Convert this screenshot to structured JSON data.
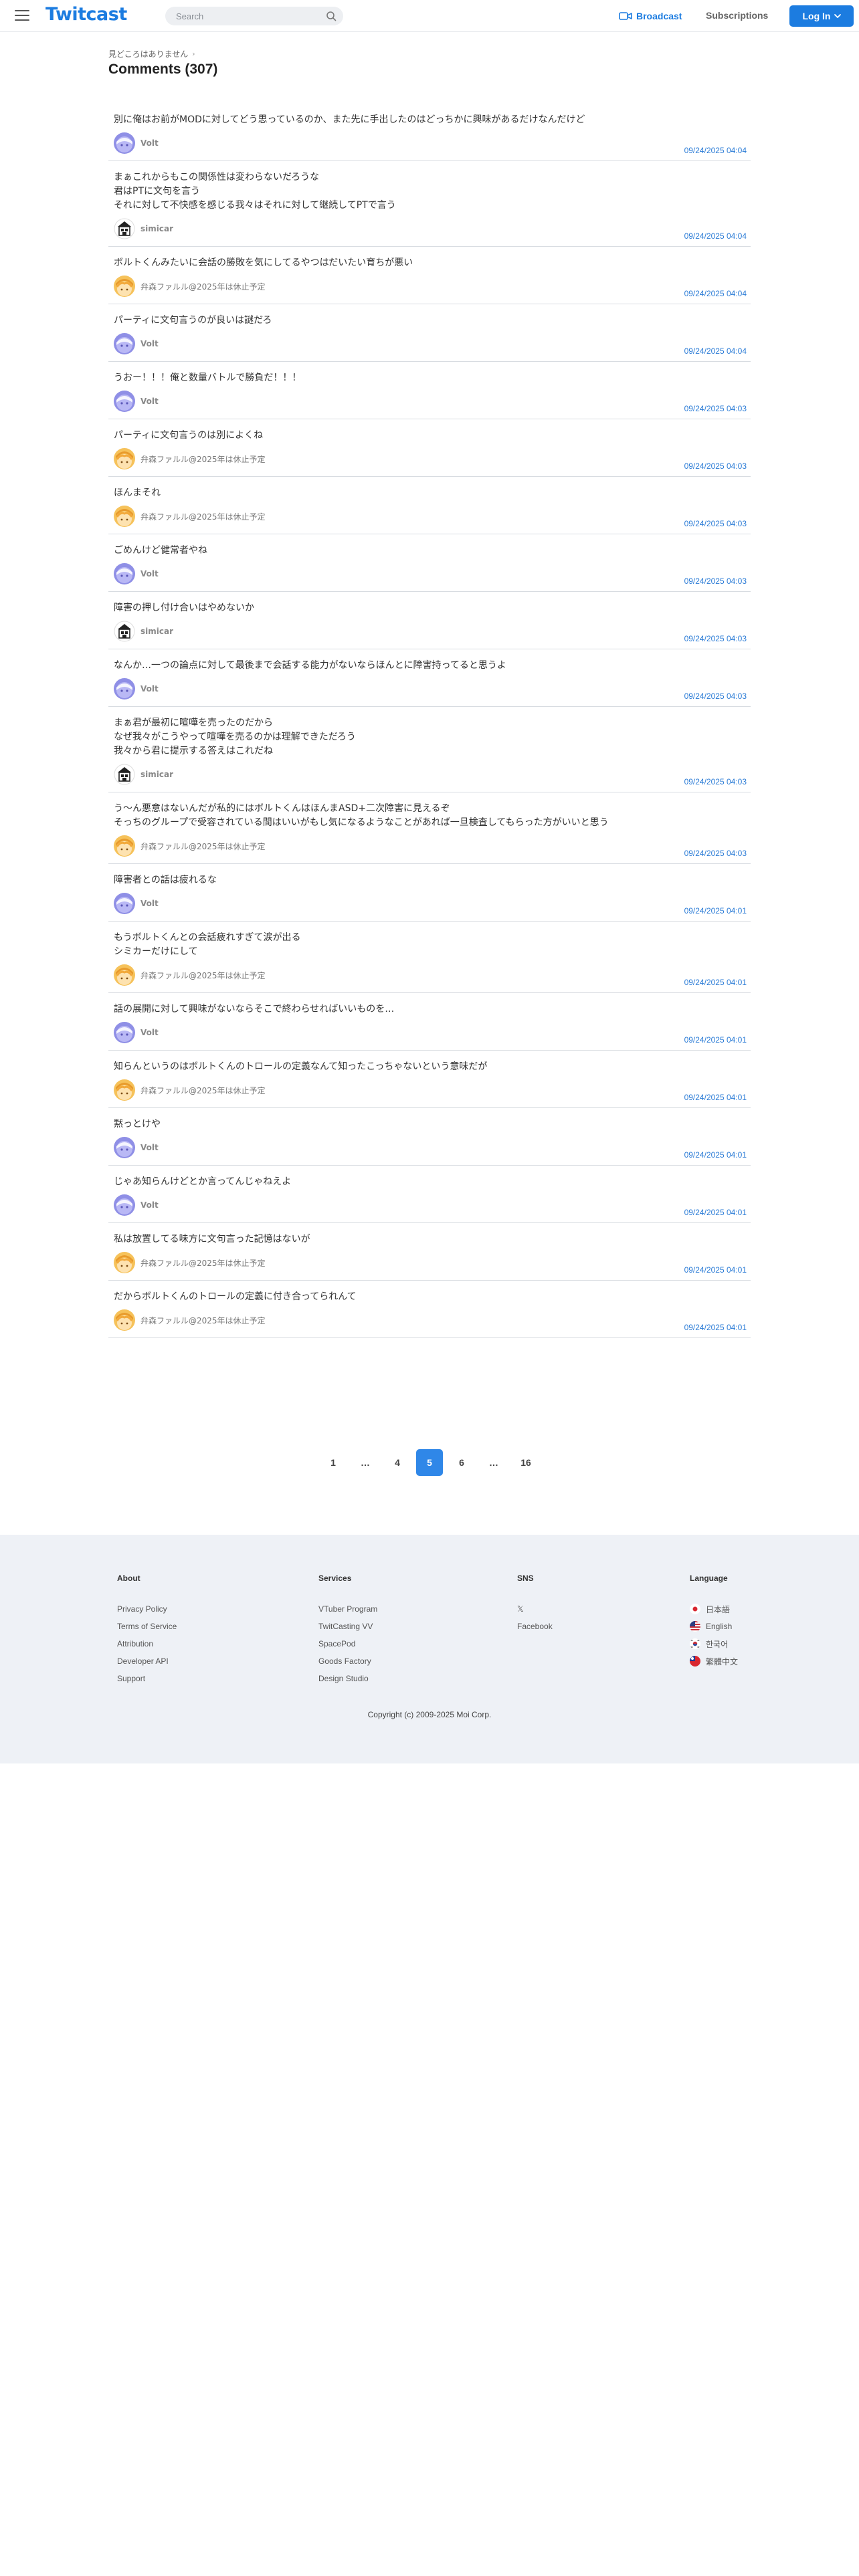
{
  "header": {
    "logo": "Twitcast",
    "search_placeholder": "Search",
    "broadcast_label": "Broadcast",
    "subscriptions_label": "Subscriptions",
    "login_label": "Log In",
    "accent_color": "#1c7ce0"
  },
  "breadcrumb": "見どころはありません",
  "page_title": "Comments (307)",
  "comments": [
    {
      "text": "別に俺はお前がMODに対してどう思っているのか、また先に手出したのはどっちかに興味があるだけなんだけど",
      "author": "Volt",
      "avatar": "volt",
      "time": "09/24/2025 04:04"
    },
    {
      "text": "まぁこれからもこの関係性は変わらないだろうな\n君はPTに文句を言う\nそれに対して不快感を感じる我々はそれに対して継続してPTで言う",
      "author": "simicar",
      "avatar": "simicar",
      "time": "09/24/2025 04:04"
    },
    {
      "text": "ボルトくんみたいに会話の勝敗を気にしてるやつはだいたい育ちが悪い",
      "author": "弁森ファルル@2025年は休止予定",
      "avatar": "fallu",
      "time": "09/24/2025 04:04"
    },
    {
      "text": "パーティに文句言うのが良いは謎だろ",
      "author": "Volt",
      "avatar": "volt",
      "time": "09/24/2025 04:04"
    },
    {
      "text": "うおー！！！俺と数量バトルで勝負だ！！！",
      "author": "Volt",
      "avatar": "volt",
      "time": "09/24/2025 04:03"
    },
    {
      "text": "パーティに文句言うのは別によくね",
      "author": "弁森ファルル@2025年は休止予定",
      "avatar": "fallu",
      "time": "09/24/2025 04:03"
    },
    {
      "text": "ほんまそれ",
      "author": "弁森ファルル@2025年は休止予定",
      "avatar": "fallu",
      "time": "09/24/2025 04:03"
    },
    {
      "text": "ごめんけど健常者やね",
      "author": "Volt",
      "avatar": "volt",
      "time": "09/24/2025 04:03"
    },
    {
      "text": "障害の押し付け合いはやめないか",
      "author": "simicar",
      "avatar": "simicar",
      "time": "09/24/2025 04:03"
    },
    {
      "text": "なんか…一つの論点に対して最後まで会話する能力がないならほんとに障害持ってると思うよ",
      "author": "Volt",
      "avatar": "volt",
      "time": "09/24/2025 04:03"
    },
    {
      "text": "まぁ君が最初に喧嘩を売ったのだから\nなぜ我々がこうやって喧嘩を売るのかは理解できただろう\n我々から君に提示する答えはこれだね",
      "author": "simicar",
      "avatar": "simicar",
      "time": "09/24/2025 04:03"
    },
    {
      "text": "う〜ん悪意はないんだが私的にはボルトくんはほんまASD+二次障害に見えるぞ\nそっちのグループで受容されている間はいいがもし気になるようなことがあれば一旦検査してもらった方がいいと思う",
      "author": "弁森ファルル@2025年は休止予定",
      "avatar": "fallu",
      "time": "09/24/2025 04:03"
    },
    {
      "text": "障害者との話は疲れるな",
      "author": "Volt",
      "avatar": "volt",
      "time": "09/24/2025 04:01"
    },
    {
      "text": "もうボルトくんとの会話疲れすぎて涙が出る\nシミカーだけにして",
      "author": "弁森ファルル@2025年は休止予定",
      "avatar": "fallu",
      "time": "09/24/2025 04:01"
    },
    {
      "text": "話の展開に対して興味がないならそこで終わらせればいいものを…",
      "author": "Volt",
      "avatar": "volt",
      "time": "09/24/2025 04:01"
    },
    {
      "text": "知らんというのはボルトくんのトロールの定義なんて知ったこっちゃないという意味だが",
      "author": "弁森ファルル@2025年は休止予定",
      "avatar": "fallu",
      "time": "09/24/2025 04:01"
    },
    {
      "text": "黙っとけや",
      "author": "Volt",
      "avatar": "volt",
      "time": "09/24/2025 04:01"
    },
    {
      "text": "じゃあ知らんけどとか言ってんじゃねえよ",
      "author": "Volt",
      "avatar": "volt",
      "time": "09/24/2025 04:01"
    },
    {
      "text": "私は放置してる味方に文句言った記憶はないが",
      "author": "弁森ファルル@2025年は休止予定",
      "avatar": "fallu",
      "time": "09/24/2025 04:01"
    },
    {
      "text": "だからボルトくんのトロールの定義に付き合ってられんて",
      "author": "弁森ファルル@2025年は休止予定",
      "avatar": "fallu",
      "time": "09/24/2025 04:01"
    }
  ],
  "pagination": {
    "pages": [
      "1",
      "…",
      "4",
      "5",
      "6",
      "…",
      "16"
    ],
    "current": "5"
  },
  "footer": {
    "columns": [
      {
        "heading": "About",
        "links": [
          "Privacy Policy",
          "Terms of Service",
          "Attribution",
          "Developer API",
          "Support"
        ]
      },
      {
        "heading": "Services",
        "links": [
          "VTuber Program",
          "TwitCasting VV",
          "SpacePod",
          "Goods Factory",
          "Design Studio"
        ]
      },
      {
        "heading": "SNS",
        "links": [
          "𝕏",
          "Facebook"
        ]
      },
      {
        "heading": "Language",
        "links": [
          "日本語",
          "English",
          "한국어",
          "繁體中文"
        ]
      }
    ],
    "copyright": "Copyright (c) 2009-2025 Moi Corp."
  }
}
